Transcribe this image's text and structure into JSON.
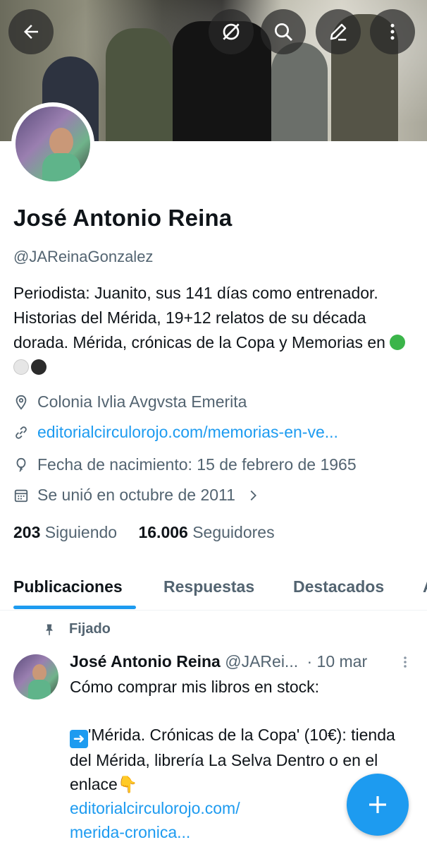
{
  "header": {
    "back_icon": "arrow-left-icon",
    "grok_icon": "grok-icon",
    "search_icon": "search-icon",
    "edit_icon": "edit-icon",
    "more_icon": "more-vertical-icon"
  },
  "profile": {
    "name": "José Antonio Reina",
    "handle": "@JAReinaGonzalez",
    "bio_text": "Periodista: Juanito, sus 141 días como entrenador. Historias del Mérida, 19+12 relatos de su década dorada. Mérida, crónicas de la Copa y Memorias en",
    "bio_dots": [
      "#3bb54a",
      "#e6e6e6",
      "#2b2b2b"
    ],
    "location": "Colonia Ivlia Avgvsta Emerita",
    "website": "editorialcirculorojo.com/memorias-en-ve...",
    "birthdate": "Fecha de nacimiento: 15 de febrero de 1965",
    "joined": "Se unió en octubre de 2011",
    "following_count": "203",
    "following_label": "Siguiendo",
    "followers_count": "16.006",
    "followers_label": "Seguidores"
  },
  "tabs": [
    {
      "label": "Publicaciones"
    },
    {
      "label": "Respuestas"
    },
    {
      "label": "Destacados"
    }
  ],
  "post": {
    "pinned_label": "Fijado",
    "author": "José Antonio Reina",
    "handle": "@JARei...",
    "date": "· 10 mar",
    "line1": "Cómo comprar mis libros en stock:",
    "line2": "'Mérida. Crónicas de la Copa' (10€): tienda del Mérida, librería La Selva Dentro o en el enlace",
    "link_line1": "editorialcirculorojo.com/",
    "link_line2": "merida-cronica..."
  },
  "colors": {
    "accent": "#1d9bf0",
    "text_secondary": "#536471"
  }
}
